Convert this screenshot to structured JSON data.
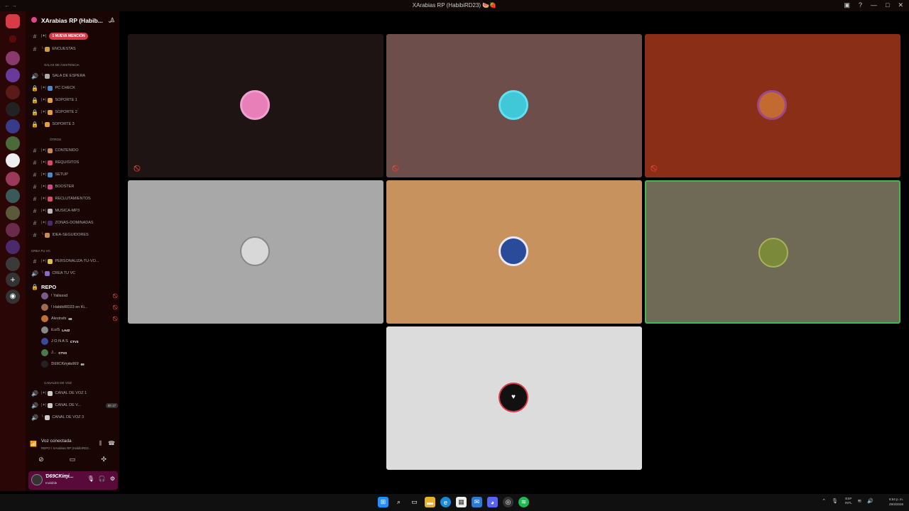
{
  "window": {
    "title": "XArabias RP (HabibiRD23) 🍉🍓",
    "controls": [
      "minimize",
      "maximize",
      "close"
    ]
  },
  "guild": {
    "name": "XArabias RP (Habib...",
    "icon": "server-icon"
  },
  "channels": [
    {
      "type": "text",
      "label": "|✦|",
      "badge": "1 NUEVA MENCIÓN"
    },
    {
      "type": "text",
      "label": "ENCUESTAS"
    },
    {
      "type": "category",
      "label": "SALAS DE ASISTENCIA"
    },
    {
      "type": "voice",
      "label": "SALA DE ESPERA"
    },
    {
      "type": "locked",
      "label": "PC CHECK"
    },
    {
      "type": "locked",
      "label": "SOPORTE 1"
    },
    {
      "type": "locked",
      "label": "SOPORTE 2"
    },
    {
      "type": "locked",
      "label": "SOPORTE 3"
    },
    {
      "type": "category",
      "label": "OTROS"
    },
    {
      "type": "text",
      "label": "CONTENIDO"
    },
    {
      "type": "text",
      "label": "REQUISITOS"
    },
    {
      "type": "text",
      "label": "SETUP"
    },
    {
      "type": "text",
      "label": "BOOSTER"
    },
    {
      "type": "text",
      "label": "RECLUTAMIENTOS"
    },
    {
      "type": "text",
      "label": "MUSICA-MP3"
    },
    {
      "type": "text",
      "label": "ZONAS-DOMINADAS"
    },
    {
      "type": "text",
      "label": "IDEA-SEGUIDORES"
    },
    {
      "type": "category",
      "label": "CREA TU VC"
    },
    {
      "type": "text",
      "label": "PERSONALIZA-TU-VO..."
    },
    {
      "type": "voice",
      "label": "CREA TU VC"
    }
  ],
  "active_voice_channel": "REPO",
  "members": [
    {
      "name": "! Yalisxxd",
      "tag": "",
      "color": "#7a5a8a"
    },
    {
      "name": "! HabibiRD23 en Ki...",
      "tag": "",
      "color": "#a06a50"
    },
    {
      "name": "Alextrafs",
      "tag": "69",
      "color": "#c07030"
    },
    {
      "name": "iLuiS",
      "tag": "LA42",
      "color": "#888888"
    },
    {
      "name": "J O N A S",
      "tag": "CTV3",
      "color": "#3a4a9a"
    },
    {
      "name": "J...",
      "tag": "CTV3",
      "color": "#4a7a4a"
    },
    {
      "name": "Ɗ69CƘɨɱɨɬa969",
      "tag": "69",
      "color": "#222222"
    }
  ],
  "voice_channels": [
    {
      "type": "category",
      "label": "CANALES DE VOZ"
    },
    {
      "type": "voice",
      "label": "CANAL DE VOZ 1"
    },
    {
      "type": "voice",
      "label": "CANAL DE V...",
      "count_a": "00",
      "count_b": "17"
    },
    {
      "type": "voice",
      "label": "CANAL DE VOZ 3"
    }
  ],
  "voice_status": {
    "connected_label": "Voz conectada",
    "channel_path": "REPO / XArabias RP (HabibiRD2..."
  },
  "user": {
    "name": "Ɗ69CƘɨɱɨ...",
    "status": "Invisible"
  },
  "tiles": [
    {
      "bg": "#1e1414",
      "avatar_color": "#e87fb8",
      "muted": true
    },
    {
      "bg": "#6e4e4a",
      "avatar_color": "#40c8d8",
      "muted": true
    },
    {
      "bg": "#8a2e18",
      "avatar_color": "#c26a30",
      "muted": true
    },
    {
      "bg": "#a8a8a8",
      "avatar_color": "#d8d8d8",
      "muted": false
    },
    {
      "bg": "#c8925e",
      "avatar_color": "#2a4a9a",
      "muted": false
    },
    {
      "bg": "#6e6a56",
      "avatar_color": "#7a8a3a",
      "muted": false,
      "speaking": true
    },
    {
      "bg": "#dcdcdc",
      "avatar_color": "#111111",
      "muted": false
    }
  ],
  "taskbar": {
    "lang_1": "ESP",
    "lang_2": "INTL",
    "time": "8:54 p. m.",
    "date": "29/3/2026"
  },
  "colors": {
    "sidebar_bg": "#1a0505",
    "server_bar_bg": "#2a0606",
    "mention_badge": "#d93b46",
    "speaking_border": "#3fb950",
    "userbar_bg": "#5a0a3a"
  }
}
